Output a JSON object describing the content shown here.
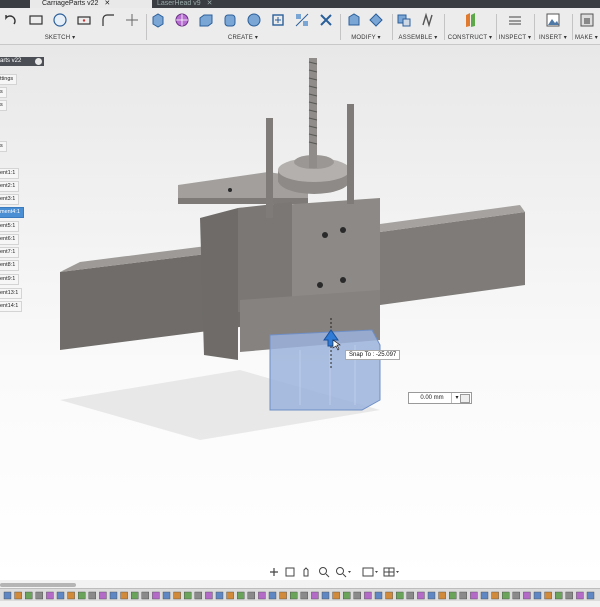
{
  "tabs": [
    {
      "label": "CarriageParts v22",
      "close": "✕"
    },
    {
      "label": "LaserHead v9",
      "close": "✕"
    }
  ],
  "toolbar": {
    "groups": [
      "SKETCH ▾",
      "CREATE ▾",
      "MODIFY ▾",
      "ASSEMBLE ▾",
      "CONSTRUCT ▾",
      "INSPECT ▾",
      "INSERT ▾",
      "MAKE ▾"
    ]
  },
  "browser": {
    "title": "arts v22",
    "items": [
      "ttings",
      "s",
      "s",
      "s",
      "ent1:1",
      "ent2:1",
      "ent3:1",
      "ment4:1",
      "ent5:1",
      "ent6:1",
      "ent7:1",
      "ent8:1",
      "ent9:1",
      "ent13:1",
      "ent14:1"
    ],
    "selected_index": 7
  },
  "snap_tooltip": "Snap To : -25.097",
  "dimension": {
    "value": "0.00 mm",
    "dropdown": "▾"
  },
  "colors": {
    "accent": "#4a8fd4",
    "model": "#8a8784",
    "selection": "#9bb3dc"
  }
}
